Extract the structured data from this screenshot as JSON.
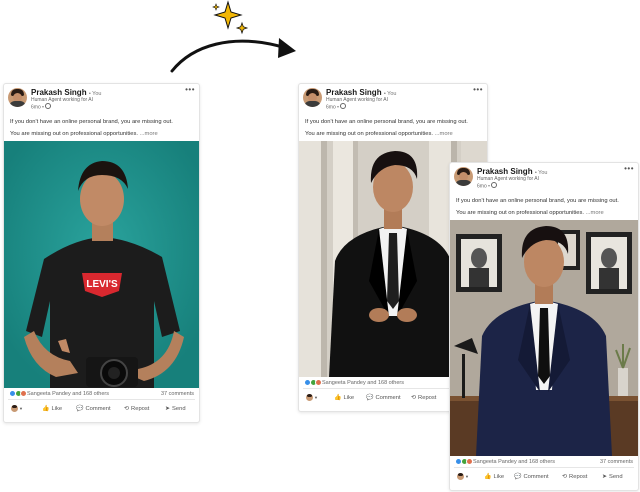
{
  "colors": {
    "sparkle": "#f2b705",
    "teal_backdrop": "#1f948f",
    "like_blue": "#378fe9",
    "celebrate_green": "#44a33c",
    "love_red": "#df704d"
  },
  "cards": [
    {
      "author": "Prakash Singh",
      "you_tag": "• You",
      "headline": "Human Agent working for AI",
      "time": "6mo •",
      "text1": "If you don't have an online personal brand, you are missing out.",
      "text2": "You are missing out on professional opportunities.",
      "more": "...more",
      "reactions_text": "Sangeeta Pandey and 168 others",
      "comments": "37 comments",
      "actions": {
        "like": "Like",
        "comment": "Comment",
        "repost": "Repost",
        "send": "Send"
      },
      "photo": "casual-tshirt-camera-teal-backdrop"
    },
    {
      "author": "Prakash Singh",
      "you_tag": "• You",
      "headline": "Human Agent working for AI",
      "time": "6mo •",
      "text1": "If you don't have an online personal brand, you are missing out.",
      "text2": "You are missing out on professional opportunities.",
      "more": "...more",
      "reactions_text": "Sangeeta Pandey and 168 others",
      "comments": "",
      "actions": {
        "like": "Like",
        "comment": "Comment",
        "repost": "Repost",
        "send": ""
      },
      "photo": "black-suit-classical-columns"
    },
    {
      "author": "Prakash Singh",
      "you_tag": "• You",
      "headline": "Human Agent working for AI",
      "time": "6mo •",
      "text1": "If you don't have an online personal brand, you are missing out.",
      "text2": "You are missing out on professional opportunities.",
      "more": "...more",
      "reactions_text": "Sangeeta Pandey and 168 others",
      "comments": "37 comments",
      "actions": {
        "like": "Like",
        "comment": "Comment",
        "repost": "Repost",
        "send": "Send"
      },
      "photo": "navy-suit-office-with-framed-portraits"
    }
  ]
}
